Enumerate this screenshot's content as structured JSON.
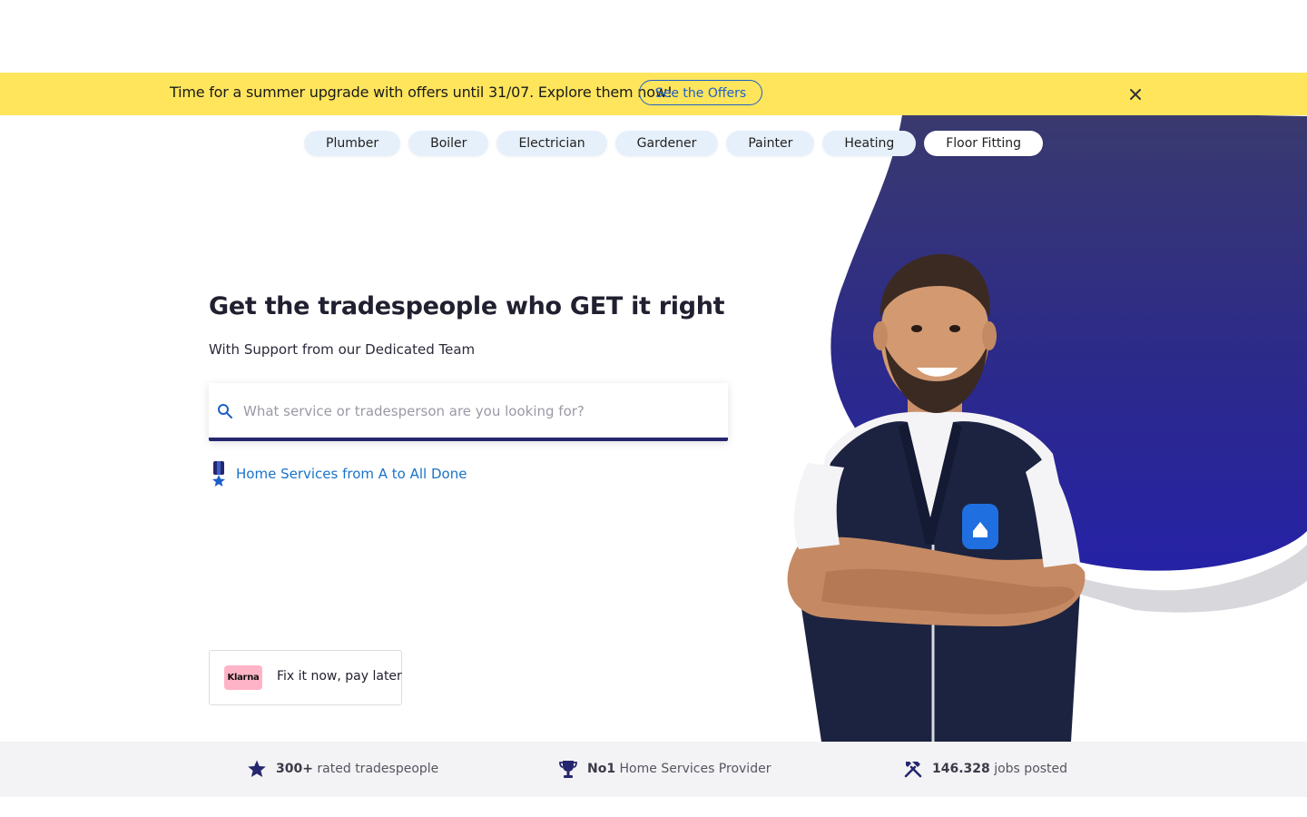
{
  "promo": {
    "text": "Time for a summer upgrade with offers until 31/07. Explore them now!",
    "button_label": "See the Offers",
    "close_icon": "close-icon"
  },
  "categories": [
    "Plumber",
    "Boiler",
    "Electrician",
    "Gardener",
    "Painter",
    "Heating",
    "Floor Fitting"
  ],
  "hero": {
    "title": "Get the tradespeople who GET it right",
    "subtitle": "With Support from our Dedicated Team",
    "search_placeholder": "What service or tradesperson are you looking for?",
    "link_text": "Home Services from A to All Done",
    "klarna_logo": "Klarna",
    "klarna_text": "Fix it now, pay later"
  },
  "stats": {
    "rated_value": "300+",
    "rated_label": "rated tradespeople",
    "no1_value": "No1",
    "no1_label": "Home Services Provider",
    "jobs_value": "146.328",
    "jobs_label": "jobs posted"
  },
  "colors": {
    "promo_bg": "#ffe55c",
    "accent_blue": "#1d5fc9",
    "navy": "#25276e",
    "link_blue": "#1a73c9",
    "klarna_pink": "#ffb3c7"
  }
}
